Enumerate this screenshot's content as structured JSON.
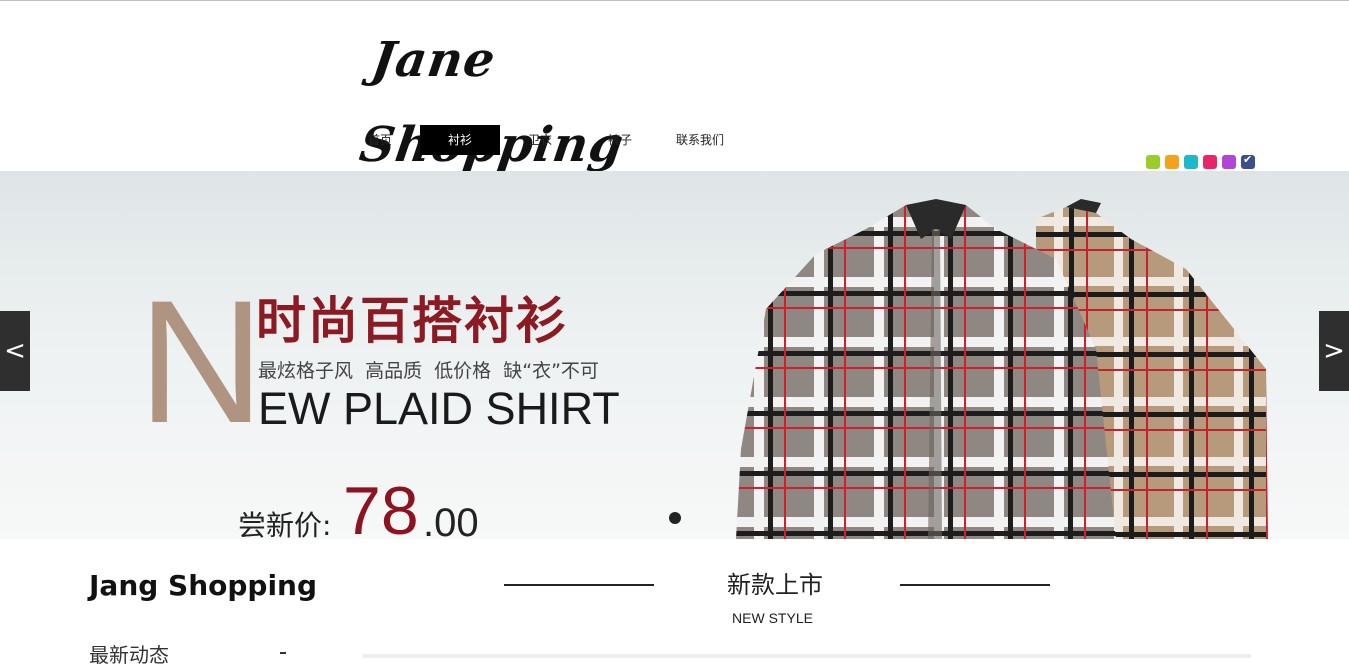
{
  "header": {
    "logo_text": "Jane Shopping"
  },
  "nav": {
    "items": [
      {
        "label": "首页"
      },
      {
        "label": "衬衫"
      },
      {
        "label": "卫衣"
      },
      {
        "label": "裤子"
      },
      {
        "label": "联系我们"
      }
    ],
    "active": "衬衫"
  },
  "theme_swatches": [
    {
      "color": "#9ccc2a"
    },
    {
      "color": "#f4a21b"
    },
    {
      "color": "#1fb8c8"
    },
    {
      "color": "#e8256b"
    },
    {
      "color": "#b046d6"
    },
    {
      "color": "#3d4f8a",
      "selected": true
    }
  ],
  "banner": {
    "big_letter": "N",
    "headline": "时尚百搭衬衫",
    "subline": "最炫格子风  高品质  低价格  缺“衣”不可",
    "english": "EW PLAID SHIRT",
    "price_label": "尝新价:",
    "price_int": "78",
    "price_dec": ".00",
    "prev_label": "<",
    "next_label": ">"
  },
  "sidebar": {
    "site_name": "Jang Shopping",
    "recent_title": "最新动态"
  },
  "section": {
    "title": "新款上市",
    "subtitle": "NEW STYLE"
  }
}
